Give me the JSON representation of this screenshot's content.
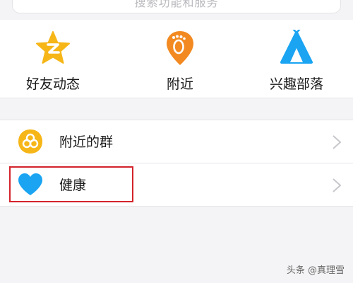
{
  "search": {
    "placeholder": "搜索功能和服务"
  },
  "quick_actions": [
    {
      "label": "好友动态",
      "icon": "qzone-star-icon",
      "color": "#f6b617"
    },
    {
      "label": "附近",
      "icon": "footprint-pin-icon",
      "color": "#f28a21"
    },
    {
      "label": "兴趣部落",
      "icon": "tent-icon",
      "color": "#1aa4f2"
    }
  ],
  "list": [
    {
      "label": "附近的群",
      "icon": "group-circles-icon",
      "color": "#f6b617"
    },
    {
      "label": "健康",
      "icon": "heart-icon",
      "color": "#1aa4f2",
      "highlighted": true
    }
  ],
  "highlight_color": "#d4232b",
  "watermark": "头条 @真理雪"
}
